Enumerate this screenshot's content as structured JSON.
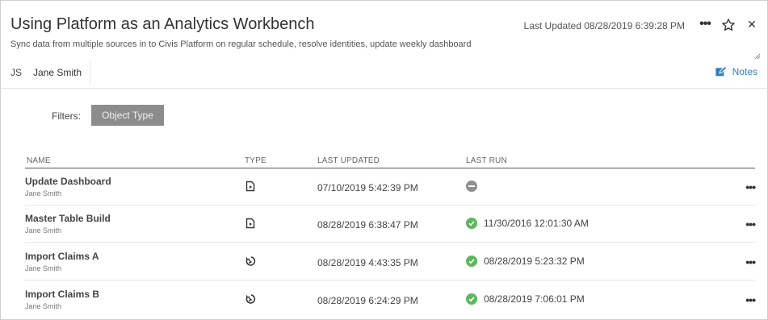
{
  "header": {
    "title": "Using Platform as an Analytics Workbench",
    "subtitle": "Sync data from multiple sources in to Civis Platform on regular schedule, resolve identities, update weekly dashboard",
    "last_updated": "Last Updated 08/28/2019 6:39:28 PM",
    "more_glyph": "•••",
    "close_glyph": "✕"
  },
  "author": {
    "initials": "JS",
    "name": "Jane Smith"
  },
  "notes": {
    "label": "Notes",
    "color": "#2f7fc1"
  },
  "filters": {
    "label": "Filters:",
    "chip": "Object Type"
  },
  "table": {
    "headers": {
      "name": "NAME",
      "type": "TYPE",
      "last_updated": "LAST UPDATED",
      "last_run": "LAST RUN"
    },
    "rows": [
      {
        "name": "Update Dashboard",
        "author": "Jane Smith",
        "type_icon": "report-icon",
        "last_updated": "07/10/2019 5:42:39 PM",
        "status": "cancelled",
        "last_run": "",
        "more": "•••"
      },
      {
        "name": "Master Table Build",
        "author": "Jane Smith",
        "type_icon": "report-icon",
        "last_updated": "08/28/2019 6:38:47 PM",
        "status": "success",
        "last_run": "11/30/2016 12:01:30 AM",
        "more": "•••"
      },
      {
        "name": "Import Claims A",
        "author": "Jane Smith",
        "type_icon": "import-icon",
        "last_updated": "08/28/2019 4:43:35 PM",
        "status": "success",
        "last_run": "08/28/2019 5:23:32 PM",
        "more": "•••"
      },
      {
        "name": "Import Claims B",
        "author": "Jane Smith",
        "type_icon": "import-icon",
        "last_updated": "08/28/2019 6:24:29 PM",
        "status": "success",
        "last_run": "08/28/2019 7:06:01 PM",
        "more": "•••"
      }
    ]
  },
  "colors": {
    "success": "#5cb85c",
    "cancelled": "#8f8f8f",
    "chip_bg": "#8c8c8c"
  }
}
